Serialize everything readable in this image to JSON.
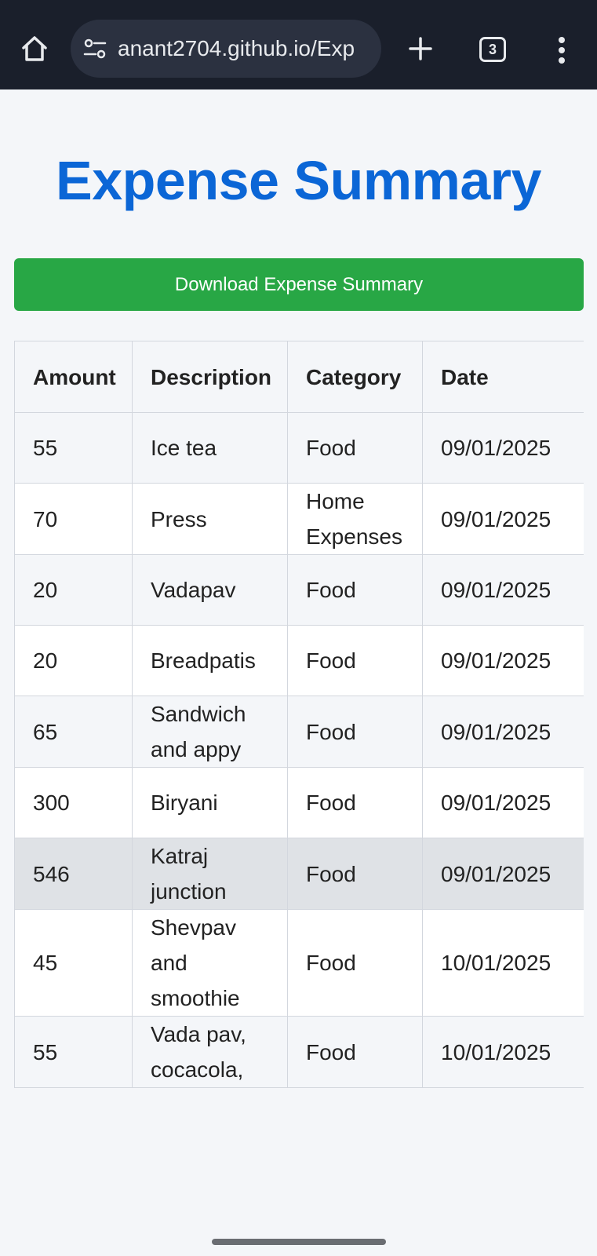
{
  "browser": {
    "url": "anant2704.github.io/Exp",
    "tab_count": "3"
  },
  "page": {
    "title": "Expense Summary",
    "download_label": "Download Expense Summary"
  },
  "table": {
    "headers": [
      "Amount",
      "Description",
      "Category",
      "Date"
    ],
    "rows": [
      {
        "amount": "55",
        "description": "Ice tea",
        "category": "Food",
        "date": "09/01/2025"
      },
      {
        "amount": "70",
        "description": "Press",
        "category": "Home Expenses",
        "date": "09/01/2025"
      },
      {
        "amount": "20",
        "description": "Vadapav",
        "category": "Food",
        "date": "09/01/2025"
      },
      {
        "amount": "20",
        "description": "Breadpatis",
        "category": "Food",
        "date": "09/01/2025"
      },
      {
        "amount": "65",
        "description": "Sandwich and appy",
        "category": "Food",
        "date": "09/01/2025"
      },
      {
        "amount": "300",
        "description": "Biryani",
        "category": "Food",
        "date": "09/01/2025"
      },
      {
        "amount": "546",
        "description": "Katraj junction",
        "category": "Food",
        "date": "09/01/2025"
      },
      {
        "amount": "45",
        "description": "Shevpav and smoothie",
        "category": "Food",
        "date": "10/01/2025"
      },
      {
        "amount": "55",
        "description": "Vada pav, cocacola,",
        "category": "Food",
        "date": "10/01/2025"
      }
    ]
  },
  "colors": {
    "title": "#0b66d6",
    "download_button": "#28a745",
    "chrome_bg": "#1a1f2b",
    "highlighted_row": "#dfe2e6"
  },
  "icons": {
    "home": "home-icon",
    "site_settings": "tune-icon",
    "new_tab": "plus-icon",
    "tab_switcher": "tab-switcher-icon",
    "menu": "more-vert-icon"
  }
}
